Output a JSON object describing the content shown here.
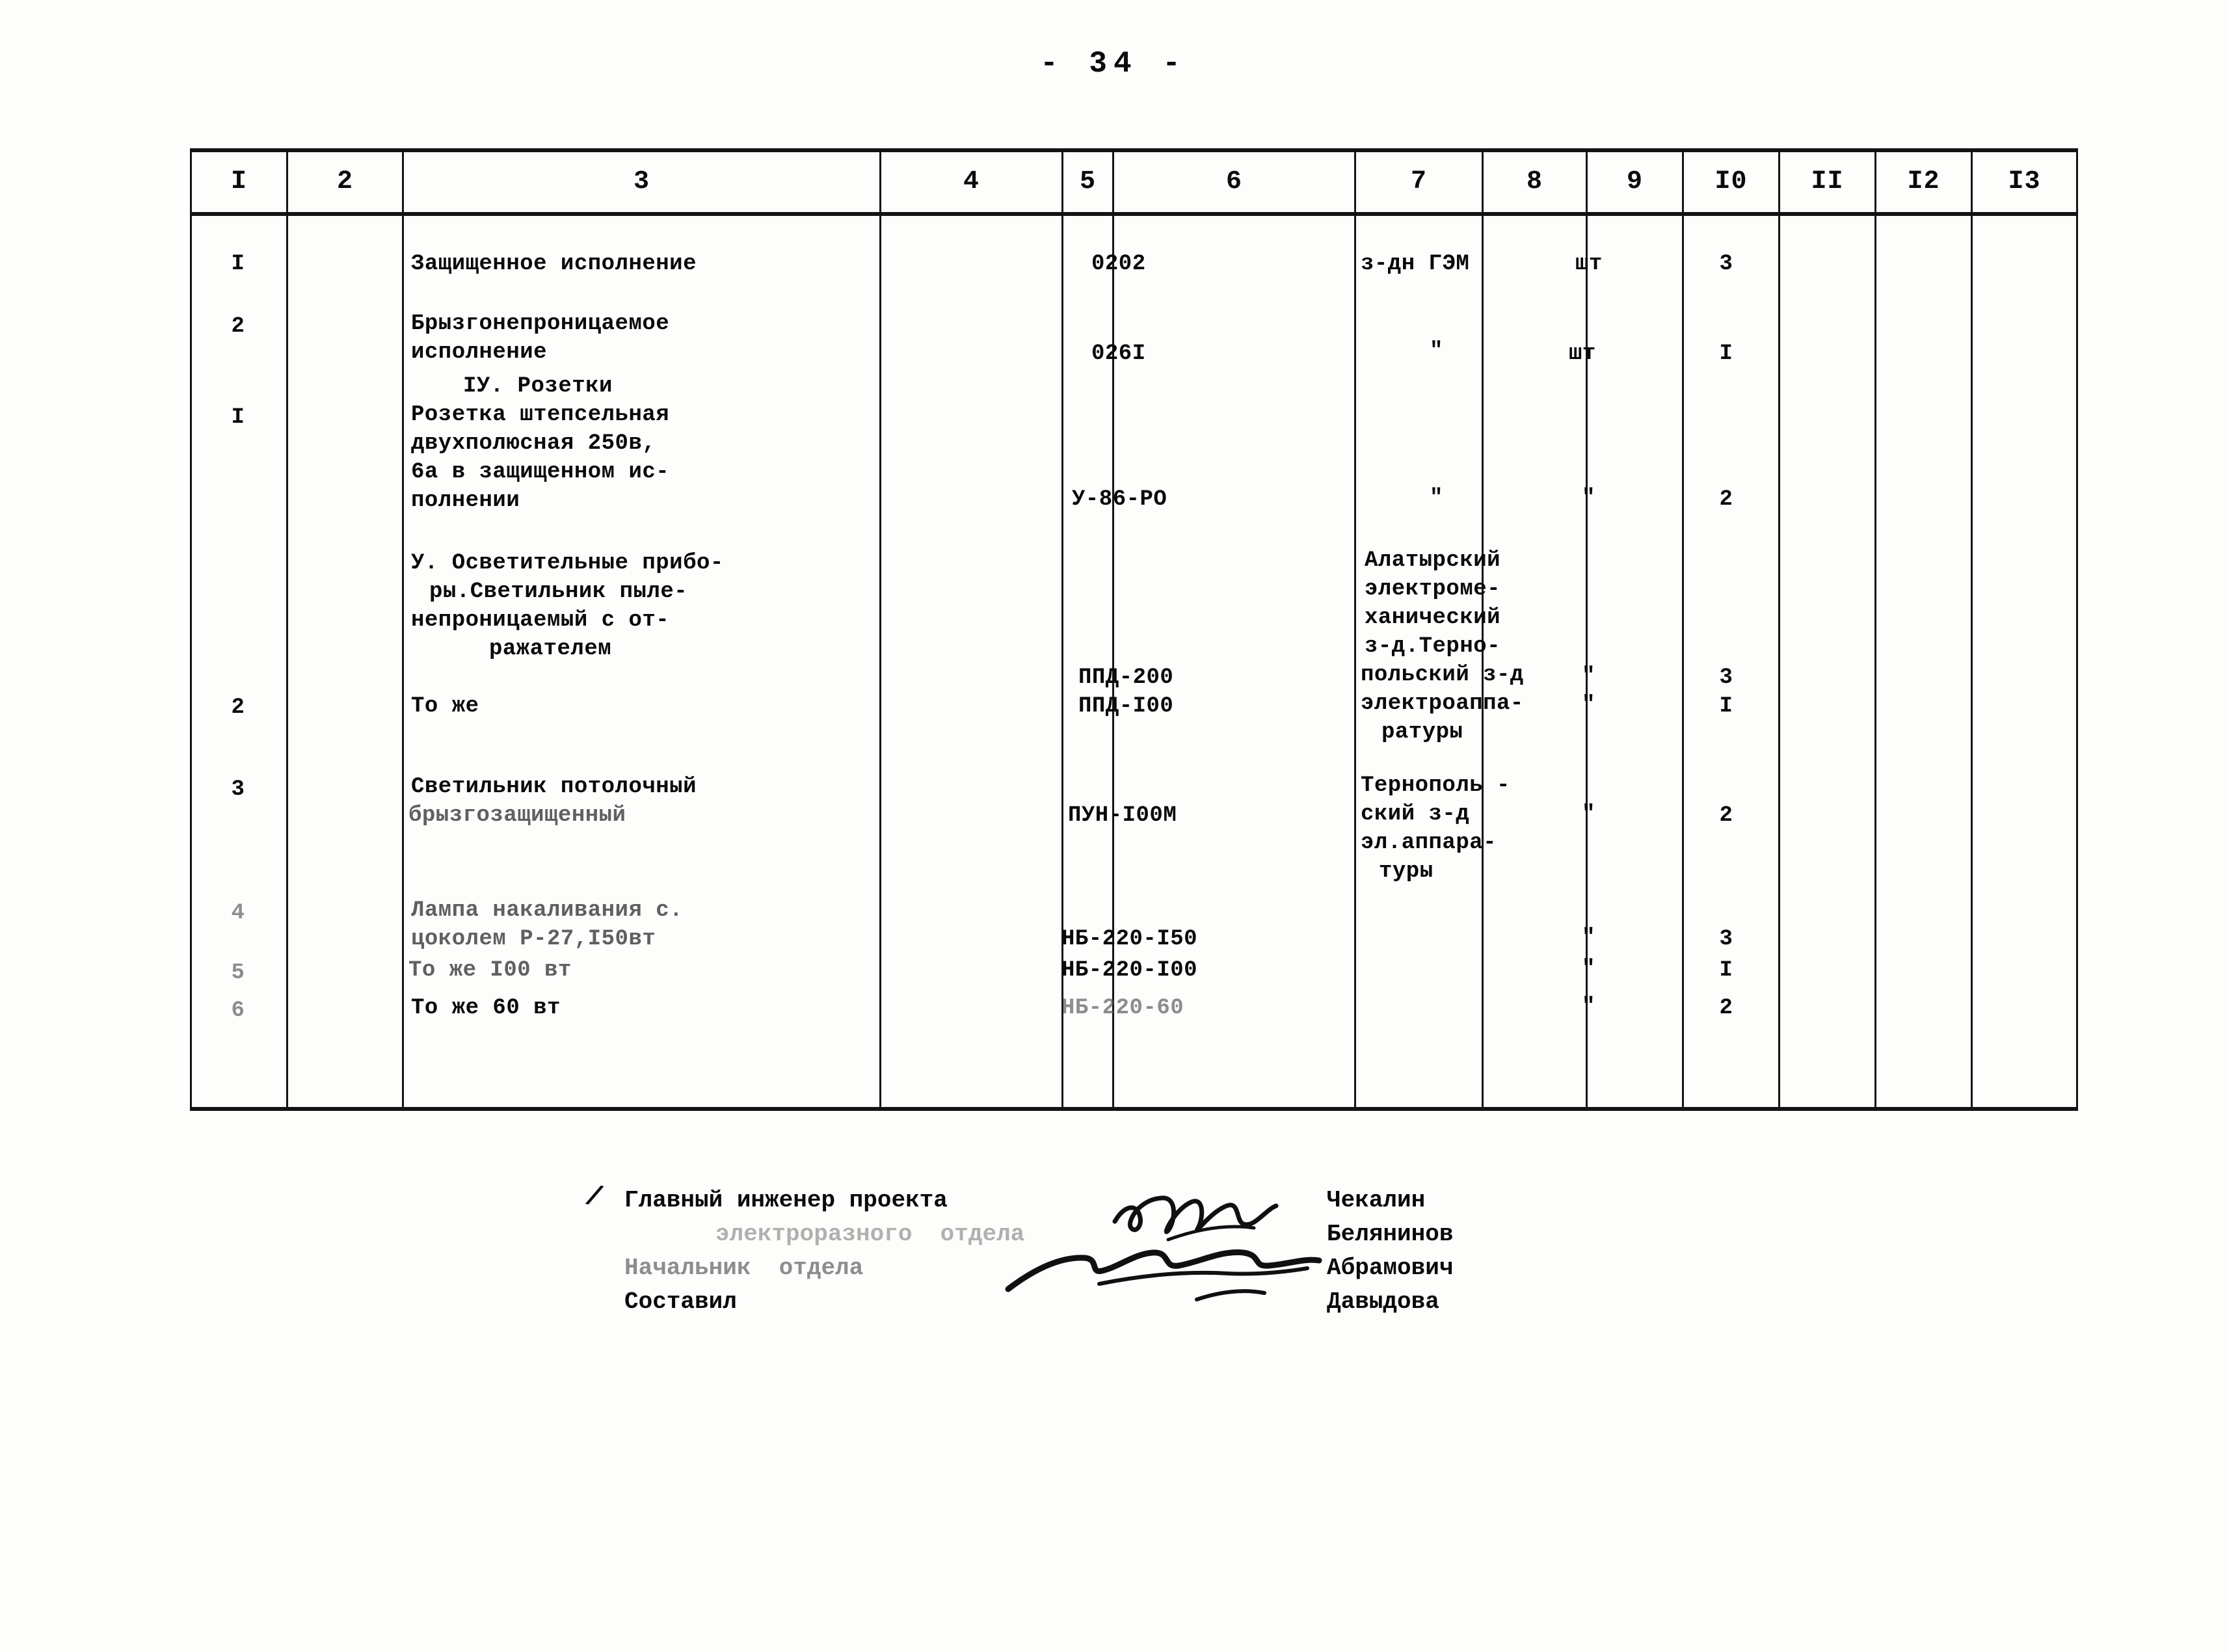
{
  "document": {
    "page_number": "- 34 -"
  },
  "table": {
    "column_headers": [
      "I",
      "2",
      "3",
      "4",
      "5",
      "6",
      "7",
      "8",
      "9",
      "I0",
      "II",
      "I2",
      "I3"
    ],
    "rows": [
      {
        "col1": "I",
        "col2": "",
        "col3": "Защищенное исполнение",
        "col4": "0202",
        "col5": "",
        "col6": "з-дн ГЭМ",
        "col7": "шт",
        "col8": "3"
      },
      {
        "col1": "2",
        "col2": "",
        "col3": "Брызгонепроницаемое\nисполнение",
        "col4": "026I",
        "col5": "",
        "col6": "\"",
        "col7": "шт",
        "col8": "I"
      },
      {
        "col1": "",
        "col2": "",
        "col3": "IУ. Розетки",
        "col4": "",
        "col5": "",
        "col6": "",
        "col7": "",
        "col8": ""
      },
      {
        "col1": "I",
        "col2": "",
        "col3": "Розетка штепсельная\nдвухполюсная 250в,\n6а в защищенном ис-\nполнении",
        "col4": "У-86-РО",
        "col5": "",
        "col6": "\"",
        "col7": "\"",
        "col8": "2"
      },
      {
        "col1": "",
        "col2": "",
        "col3": "У. Осветительные прибо-\nры.Светильник пыле-\nнепроницаемый с от-\nражателем",
        "col4": "ППД-200",
        "col5": "",
        "col6": "Алатырский\nэлектроме-\nханичческий\nз-д.Терно-\nпольский з-д\nэлектроаппа-\nратуры",
        "col7": "\"",
        "col8": "3"
      },
      {
        "col1": "2",
        "col2": "",
        "col3": "То же",
        "col4": "ППД-I00",
        "col5": "",
        "col6": "",
        "col7": "\"",
        "col8": "I"
      },
      {
        "col1": "3",
        "col2": "",
        "col3": "Светильник потолочный\nбрызгозащищенный",
        "col4": "ПУН-I00М",
        "col5": "",
        "col6": "Тернополь -\nский з-д\nэл.аппара-\nтуры",
        "col7": "\"",
        "col8": "2"
      },
      {
        "col1": "4",
        "col2": "",
        "col3": "Лампа накаливания с.\nцоколем Р-27,I50вт",
        "col4": "НБ-220-I50",
        "col5": "",
        "col6": "",
        "col7": "\"",
        "col8": "3"
      },
      {
        "col1": "5",
        "col2": "",
        "col3": "То же I00 вт",
        "col4": "НБ-220-I00",
        "col5": "",
        "col6": "",
        "col7": "\"",
        "col8": "I"
      },
      {
        "col1": "6",
        "col2": "",
        "col3": "То же 60 вт",
        "col4": "НБ-220-60",
        "col5": "",
        "col6": "",
        "col7": "\"",
        "col8": "2"
      }
    ],
    "cells": {
      "r1_c1": "I",
      "r1_c3": "Защищенное исполнение",
      "r1_c4": "0202",
      "r1_c6": "з-дн ГЭМ",
      "r1_c7": "шт",
      "r1_c8": "3",
      "r2_c1": "2",
      "r2_c3a": "Брызгонепроницаемое",
      "r2_c3b": "исполнение",
      "r2_c4": "026I",
      "r2_c6": "\"",
      "r2_c7": "шт",
      "r2_c8": "I",
      "sec4": "IУ. Розетки",
      "r3_c1": "I",
      "r3_c3a": "Розетка штепсельная",
      "r3_c3b": "двухполюсная 250в,",
      "r3_c3c": "6а в защищенном ис-",
      "r3_c3d": "полнении",
      "r3_c4": "У-86-РО",
      "r3_c6": "\"",
      "r3_c7": "\"",
      "r3_c8": "2",
      "sec5a": "У. Осветительные прибо-",
      "sec5b": "ры.Светильник пыле-",
      "sec5c": "непроницаемый с от-",
      "sec5d": "ражателем",
      "r4_c4": "ППД-200",
      "r4_c6a": "Алатырский",
      "r4_c6b": "электроме-",
      "r4_c6c": "ханический",
      "r4_c6d": "з-д.Терно-",
      "r4_c6e": "польский з-д",
      "r4_c6f": "электроаппа-",
      "r4_c6g": "ратуры",
      "r4_c7": "\"",
      "r4_c8": "3",
      "r5_c1": "2",
      "r5_c3": "То же",
      "r5_c4": "ППД-I00",
      "r5_c7": "\"",
      "r5_c8": "I",
      "r6_c1": "3",
      "r6_c3a": "Светильник потолочный",
      "r6_c3b": "брызгозащищенный",
      "r6_c4": "ПУН-I00М",
      "r6_c6a": "Тернополь -",
      "r6_c6b": "ский з-д",
      "r6_c6c": "эл.аппара-",
      "r6_c6d": "туры",
      "r6_c7": "\"",
      "r6_c8": "2",
      "r7_c1": "4",
      "r7_c3a": "Лампа накаливания с.",
      "r7_c3b": "цоколем Р-27,I50вт",
      "r7_c4": "НБ-220-I50",
      "r7_c7": "\"",
      "r7_c8": "3",
      "r8_c1": "5",
      "r8_c3": "То же I00 вт",
      "r8_c4": "НБ-220-I00",
      "r8_c7": "\"",
      "r8_c8": "I",
      "r9_c1": "6",
      "r9_c3": "То же 60 вт",
      "r9_c4": "НБ-220-60",
      "r9_c7": "\"",
      "r9_c8": "2"
    }
  },
  "signatures": {
    "slash": "/",
    "rows": [
      {
        "label": "Главный инженер проекта",
        "name": "Чекалин"
      },
      {
        "label": "электроразного отдела",
        "name": "Белянинов"
      },
      {
        "label": "Начальник отдела",
        "name": "Абрамович"
      },
      {
        "label": "Составил",
        "name": "Давыдова"
      }
    ],
    "r1_label": "Главный инженер проекта",
    "r1_name": "Чекалин",
    "r2_label": "электроразного  отдела",
    "r2_name": "Белянинов",
    "r3_label": "Начальник  отдела",
    "r3_name": "Абрамович",
    "r4_label": "Составил",
    "r4_name": "Давыдова"
  },
  "colors": {
    "ink": "#0a0a0a",
    "paper": "#fdfdfc",
    "rule": "#131313"
  }
}
